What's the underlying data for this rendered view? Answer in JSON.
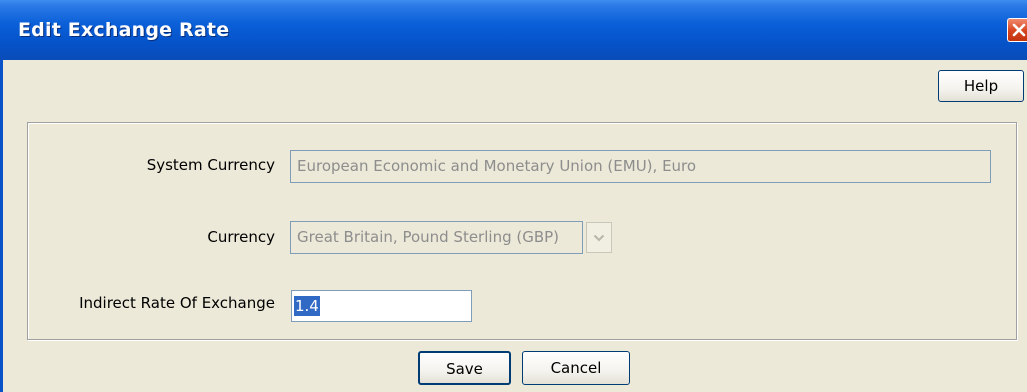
{
  "window": {
    "title": "Edit Exchange Rate",
    "close_icon": "close-icon",
    "accent_color": "#0a52c8",
    "close_color": "#d6431d"
  },
  "toolbar": {
    "help_label": "Help"
  },
  "form": {
    "system_currency": {
      "label": "System Currency",
      "value": "European Economic and Monetary Union (EMU), Euro"
    },
    "currency": {
      "label": "Currency",
      "value": "Great Britain, Pound Sterling (GBP)",
      "dropdown_icon": "chevron-down-icon"
    },
    "indirect_rate": {
      "label": "Indirect Rate Of Exchange",
      "value": "1.4"
    }
  },
  "actions": {
    "save_label": "Save",
    "cancel_label": "Cancel"
  }
}
